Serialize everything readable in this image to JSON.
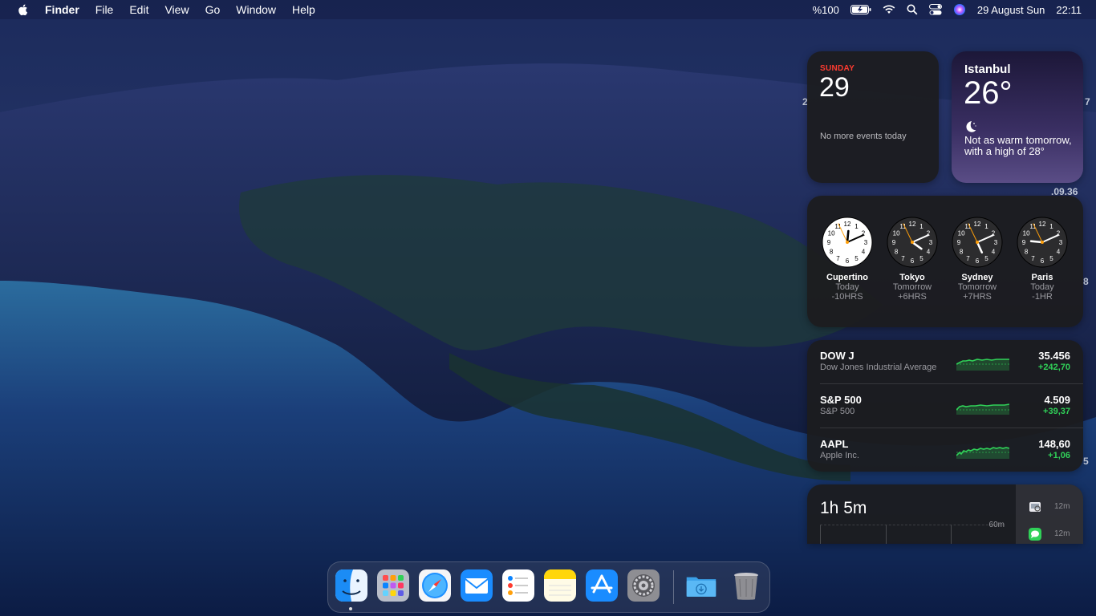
{
  "menubar": {
    "app_name": "Finder",
    "menus": [
      "File",
      "Edit",
      "View",
      "Go",
      "Window",
      "Help"
    ],
    "battery": "%100",
    "datetime": "29 August Sun",
    "time": "22:11"
  },
  "calendar_widget": {
    "day_name": "SUNDAY",
    "date": "29",
    "events_text": "No more events today"
  },
  "weather_widget": {
    "city": "Istanbul",
    "temperature": "26°",
    "condition_icon": "moon-icon",
    "forecast": "Not as warm tomorrow, with a high of 28°"
  },
  "world_clock_widget": {
    "clocks": [
      {
        "city": "Cupertino",
        "day": "Today",
        "offset": "-10HRS",
        "hour": 12,
        "minute": 11,
        "theme": "light"
      },
      {
        "city": "Tokyo",
        "day": "Tomorrow",
        "offset": "+6HRS",
        "hour": 4,
        "minute": 11,
        "theme": "dark"
      },
      {
        "city": "Sydney",
        "day": "Tomorrow",
        "offset": "+7HRS",
        "hour": 5,
        "minute": 11,
        "theme": "dark"
      },
      {
        "city": "Paris",
        "day": "Today",
        "offset": "-1HR",
        "hour": 9,
        "minute": 11,
        "theme": "dark"
      }
    ]
  },
  "stocks_widget": {
    "items": [
      {
        "symbol": "DOW J",
        "name": "Dow Jones Industrial Average",
        "price": "35.456",
        "change": "+242,70"
      },
      {
        "symbol": "S&P 500",
        "name": "S&P 500",
        "price": "4.509",
        "change": "+39,37"
      },
      {
        "symbol": "AAPL",
        "name": "Apple Inc.",
        "price": "148,60",
        "change": "+1,06"
      }
    ],
    "change_color": "#30d158"
  },
  "screentime_widget": {
    "total": "1h 5m",
    "axis_label": "60m",
    "apps": [
      {
        "icon": "preview-icon",
        "time": "12m"
      },
      {
        "icon": "messages-icon",
        "time": "12m"
      }
    ]
  },
  "edge_labels": [
    "2",
    "7",
    ".09.36",
    "8",
    "5"
  ],
  "dock": {
    "apps": [
      "finder-icon",
      "launchpad-icon",
      "safari-icon",
      "mail-icon",
      "reminders-icon",
      "notes-icon",
      "app-store-icon",
      "system-preferences-icon",
      "downloads-folder-icon",
      "trash-icon"
    ]
  }
}
